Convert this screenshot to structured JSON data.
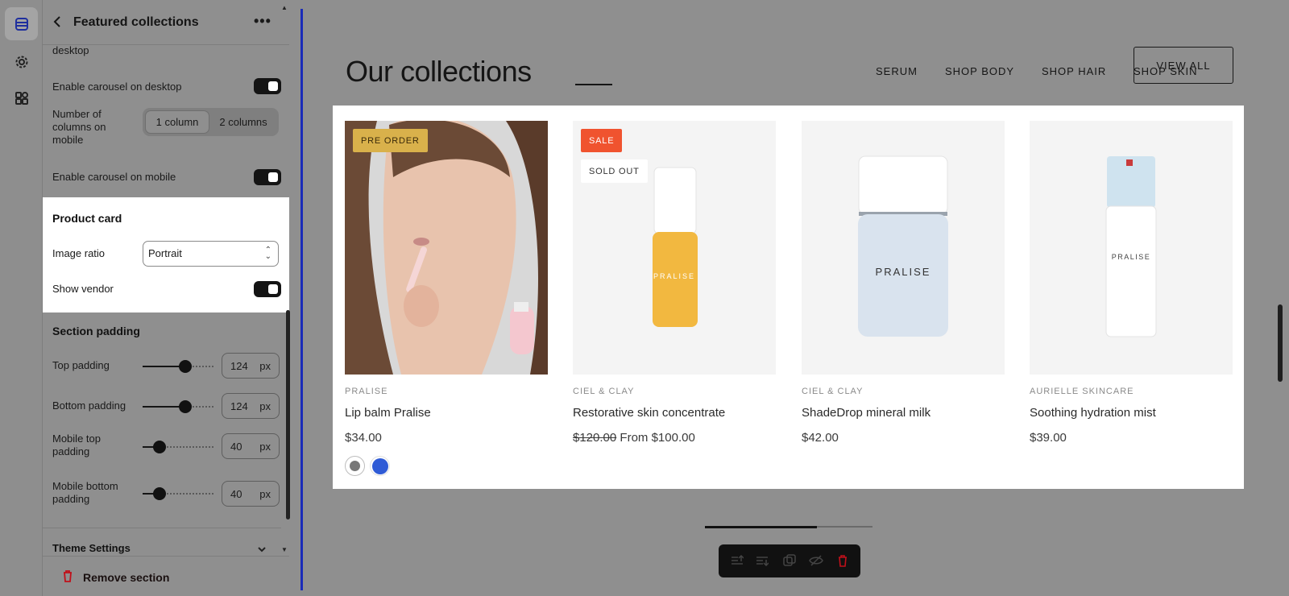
{
  "panel": {
    "title": "Featured collections",
    "truncated_label": "desktop",
    "carousel_desktop_label": "Enable carousel on desktop",
    "columns_mobile_label": "Number of columns on mobile",
    "columns_options": [
      "1 column",
      "2 columns"
    ],
    "columns_selected": "1 column",
    "carousel_mobile_label": "Enable carousel on mobile",
    "product_card": {
      "title": "Product card",
      "image_ratio_label": "Image ratio",
      "image_ratio_value": "Portrait",
      "show_vendor_label": "Show vendor"
    },
    "section_padding": {
      "title": "Section padding",
      "unit": "px",
      "rows": [
        {
          "label": "Top padding",
          "value": "124",
          "level": 0.6
        },
        {
          "label": "Bottom padding",
          "value": "124",
          "level": 0.6
        },
        {
          "label": "Mobile top padding",
          "value": "40",
          "level": 0.24
        },
        {
          "label": "Mobile bottom padding",
          "value": "40",
          "level": 0.24
        }
      ]
    },
    "theme_settings_label": "Theme Settings",
    "remove_section_label": "Remove section"
  },
  "preview": {
    "heading": "Our collections",
    "tabs": [
      "SERUM",
      "SHOP BODY",
      "SHOP HAIR",
      "SHOP SKIN"
    ],
    "active_tab": "SERUM",
    "view_all_label": "VIEW ALL",
    "products": [
      {
        "vendor": "PRALISE",
        "name": "Lip balm Pralise",
        "price": "$34.00",
        "badge": "PRE ORDER"
      },
      {
        "vendor": "CIEL & CLAY",
        "name": "Restorative skin concentrate",
        "compare_price": "$120.00",
        "price": "From $100.00",
        "badge": "SALE",
        "badge2": "SOLD OUT",
        "bottle_text": "PRALISE"
      },
      {
        "vendor": "CIEL & CLAY",
        "name": "ShadeDrop mineral milk",
        "price": "$42.00",
        "bottle_text": "PRALISE"
      },
      {
        "vendor": "AURIELLE SKINCARE",
        "name": "Soothing hydration mist",
        "price": "$39.00",
        "bottle_text": "PRALISE"
      }
    ],
    "swatch_colors": [
      "#777777",
      "#2f5bd6"
    ],
    "carousel_progress": 0.67
  },
  "colors": {
    "preorder_badge": "#d9b14b",
    "sale_badge": "#f0532f",
    "preview_accent": "#1a2bb8",
    "remove_icon": "#c0101a"
  }
}
